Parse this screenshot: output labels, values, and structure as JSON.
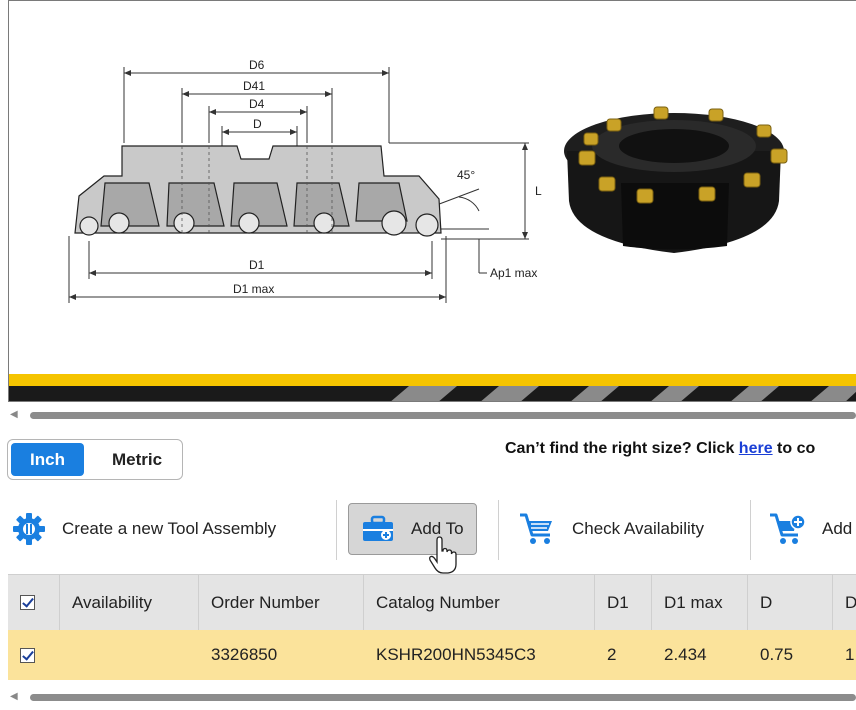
{
  "drawing": {
    "dimensions": [
      "D6",
      "D41",
      "D4",
      "D",
      "L",
      "45°",
      "D1",
      "D1 max",
      "Ap1 max"
    ]
  },
  "units": {
    "inch_label": "Inch",
    "metric_label": "Metric",
    "selected": "Inch"
  },
  "notice": {
    "prefix": "Can’t find the right size? Click ",
    "link_text": "here",
    "suffix": " to co"
  },
  "toolbar": {
    "create_label": "Create a new Tool Assembly",
    "add_to_label": "Add To",
    "check_label": "Check Availability",
    "add_label": "Add"
  },
  "table": {
    "columns": [
      "Availability",
      "Order Number",
      "Catalog Number",
      "D1",
      "D1 max",
      "D",
      "D"
    ],
    "rows": [
      {
        "checked": true,
        "availability": "",
        "order_number": "3326850",
        "catalog_number": "KSHR200HN5345C3",
        "d1": "2",
        "d1_max": "2.434",
        "d": "0.75",
        "next": "1."
      }
    ]
  },
  "colors": {
    "accent_blue": "#1a7fe0",
    "selected_row": "#fbe39b",
    "yellow_stripe": "#f5c400",
    "header_bg": "#e4e4e4"
  }
}
